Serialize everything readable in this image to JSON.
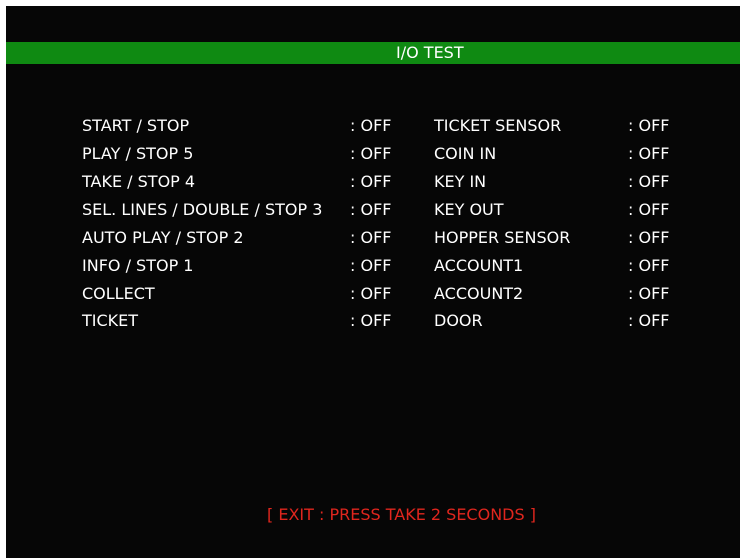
{
  "title": "I/O TEST",
  "rows": [
    {
      "left_label": "START / STOP",
      "left_status": ": OFF",
      "right_label": "TICKET SENSOR",
      "right_status": ": OFF"
    },
    {
      "left_label": "PLAY / STOP 5",
      "left_status": ": OFF",
      "right_label": "COIN IN",
      "right_status": ": OFF"
    },
    {
      "left_label": "TAKE / STOP 4",
      "left_status": ": OFF",
      "right_label": "KEY IN",
      "right_status": ": OFF"
    },
    {
      "left_label": "SEL. LINES / DOUBLE / STOP 3",
      "left_status": ": OFF",
      "right_label": "KEY OUT",
      "right_status": ": OFF"
    },
    {
      "left_label": "AUTO PLAY / STOP 2",
      "left_status": ": OFF",
      "right_label": "HOPPER SENSOR",
      "right_status": ": OFF"
    },
    {
      "left_label": "INFO / STOP 1",
      "left_status": ": OFF",
      "right_label": "ACCOUNT1",
      "right_status": ": OFF"
    },
    {
      "left_label": "COLLECT",
      "left_status": ": OFF",
      "right_label": "ACCOUNT2",
      "right_status": ": OFF"
    },
    {
      "left_label": "TICKET",
      "left_status": ": OFF",
      "right_label": "DOOR",
      "right_status": ": OFF"
    }
  ],
  "footer": "[ EXIT : PRESS TAKE 2 SECONDS ]",
  "colors": {
    "background": "#060606",
    "title_bar": "#0f8a12",
    "text": "#ffffff",
    "footer_text": "#e0261e"
  }
}
